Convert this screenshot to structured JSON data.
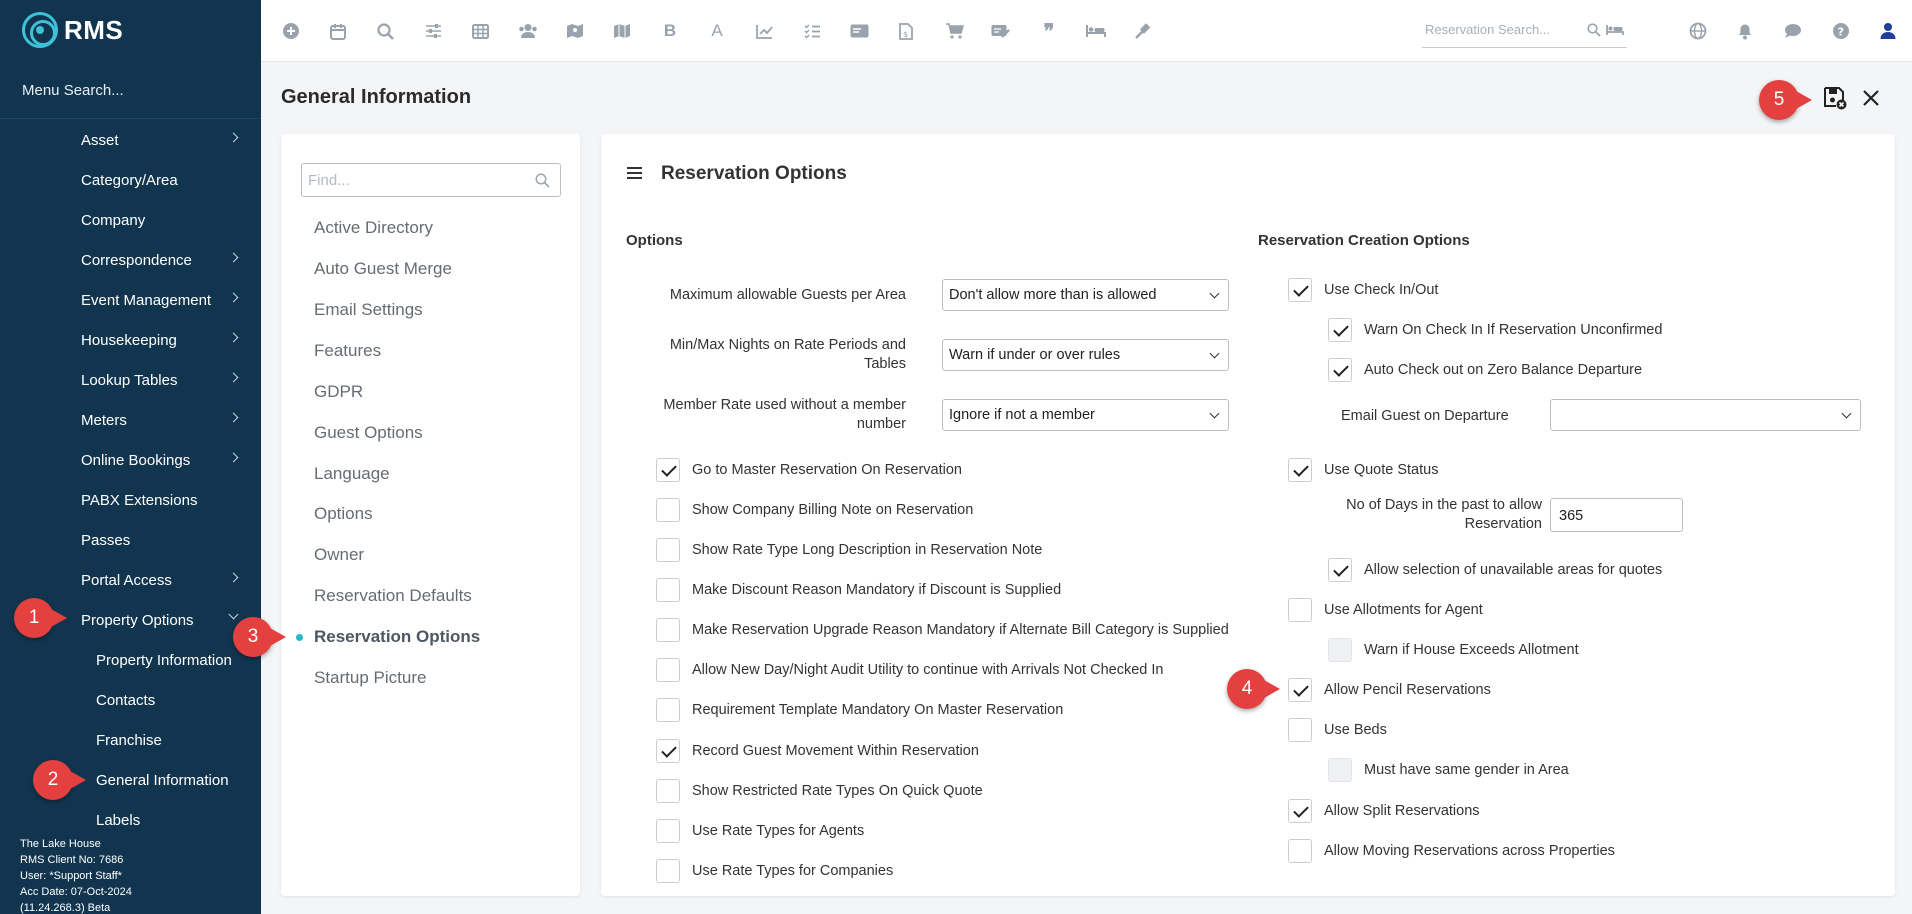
{
  "app": {
    "name": "RMS",
    "menu_search": "Menu Search..."
  },
  "sidebar": {
    "items": [
      {
        "label": "Asset",
        "has_children": true,
        "expanded": false,
        "level": 1
      },
      {
        "label": "Category/Area",
        "has_children": false,
        "level": 1
      },
      {
        "label": "Company",
        "has_children": false,
        "level": 1
      },
      {
        "label": "Correspondence",
        "has_children": true,
        "expanded": false,
        "level": 1
      },
      {
        "label": "Event Management",
        "has_children": true,
        "expanded": false,
        "level": 1
      },
      {
        "label": "Housekeeping",
        "has_children": true,
        "expanded": false,
        "level": 1
      },
      {
        "label": "Lookup Tables",
        "has_children": true,
        "expanded": false,
        "level": 1
      },
      {
        "label": "Meters",
        "has_children": true,
        "expanded": false,
        "level": 1
      },
      {
        "label": "Online Bookings",
        "has_children": true,
        "expanded": false,
        "level": 1
      },
      {
        "label": "PABX Extensions",
        "has_children": false,
        "level": 1
      },
      {
        "label": "Passes",
        "has_children": false,
        "level": 1
      },
      {
        "label": "Portal Access",
        "has_children": true,
        "expanded": false,
        "level": 1
      },
      {
        "label": "Property Options",
        "has_children": true,
        "expanded": true,
        "level": 1
      },
      {
        "label": "Property Information",
        "has_children": false,
        "level": 2
      },
      {
        "label": "Contacts",
        "has_children": false,
        "level": 2
      },
      {
        "label": "Franchise",
        "has_children": false,
        "level": 2
      },
      {
        "label": "General Information",
        "has_children": false,
        "level": 2
      },
      {
        "label": "Labels",
        "has_children": false,
        "level": 2
      }
    ],
    "footer": [
      "The Lake House",
      "RMS Client No: 7686",
      "User: *Support Staff*",
      "Acc Date: 07-Oct-2024",
      "(11.24.268.3)  Beta"
    ]
  },
  "topbar": {
    "icons": [
      "plus-circle-icon",
      "calendar-icon",
      "search-icon",
      "sliders-icon",
      "grid-icon",
      "users-icon",
      "map-pin-icon",
      "map-icon",
      "bold-icon",
      "font-icon",
      "chart-icon",
      "checklist-icon",
      "id-card-icon",
      "file-invoice-icon",
      "cart-icon",
      "ticket-edit-icon",
      "quote-icon",
      "bed-icon",
      "gavel-icon"
    ],
    "reservation_search_placeholder": "Reservation Search...",
    "right_icons": [
      "globe-icon",
      "bell-icon",
      "chat-icon",
      "help-icon",
      "user-icon"
    ]
  },
  "page": {
    "title": "General Information"
  },
  "tree": {
    "find_placeholder": "Find...",
    "items": [
      "Active Directory",
      "Auto Guest Merge",
      "Email Settings",
      "Features",
      "GDPR",
      "Guest Options",
      "Language",
      "Options",
      "Owner",
      "Reservation Defaults",
      "Reservation Options",
      "Startup Picture"
    ],
    "active": "Reservation Options"
  },
  "panel": {
    "title": "Reservation Options",
    "options": {
      "heading": "Options",
      "fields": [
        {
          "label": "Maximum allowable Guests per Area",
          "value": "Don't allow more than is allowed"
        },
        {
          "label": "Min/Max Nights on Rate Periods and Tables",
          "value": "Warn if under or over rules"
        },
        {
          "label": "Member Rate used without a member number",
          "value": "Ignore if not a member"
        }
      ],
      "checkboxes": [
        {
          "label": "Go to Master Reservation On Reservation",
          "checked": true
        },
        {
          "label": "Show Company Billing Note on Reservation",
          "checked": false
        },
        {
          "label": "Show Rate Type Long Description in Reservation Note",
          "checked": false
        },
        {
          "label": "Make Discount Reason Mandatory if Discount is Supplied",
          "checked": false
        },
        {
          "label": "Make Reservation Upgrade Reason Mandatory if Alternate Bill Category is Supplied",
          "checked": false
        },
        {
          "label": "Allow New Day/Night Audit Utility to continue with Arrivals Not Checked In",
          "checked": false
        },
        {
          "label": "Requirement Template Mandatory On Master Reservation",
          "checked": false
        },
        {
          "label": "Record Guest Movement Within Reservation",
          "checked": true
        },
        {
          "label": "Show Restricted Rate Types On Quick Quote",
          "checked": false
        },
        {
          "label": "Use Rate Types for Agents",
          "checked": false
        },
        {
          "label": "Use Rate Types for Companies",
          "checked": false
        }
      ]
    },
    "creation": {
      "heading": "Reservation Creation Options",
      "use_check_in_out": {
        "label": "Use Check In/Out",
        "checked": true
      },
      "warn_unconfirmed": {
        "label": "Warn On Check In If Reservation Unconfirmed",
        "checked": true
      },
      "auto_checkout": {
        "label": "Auto Check out on Zero Balance Departure",
        "checked": true
      },
      "email_guest": {
        "label": "Email Guest on Departure",
        "value": ""
      },
      "use_quote_status": {
        "label": "Use Quote Status",
        "checked": true
      },
      "days_past": {
        "label": "No of Days in the past to allow Reservation",
        "value": "365"
      },
      "allow_unavailable": {
        "label": "Allow selection of unavailable areas for quotes",
        "checked": true
      },
      "use_allotments": {
        "label": "Use Allotments for Agent",
        "checked": false
      },
      "warn_allotment": {
        "label": "Warn if House Exceeds Allotment",
        "checked": false
      },
      "allow_pencil": {
        "label": "Allow Pencil Reservations",
        "checked": true
      },
      "use_beds": {
        "label": "Use Beds",
        "checked": false
      },
      "same_gender": {
        "label": "Must have same gender in Area",
        "checked": false
      },
      "allow_split": {
        "label": "Allow Split Reservations",
        "checked": true
      },
      "allow_moving": {
        "label": "Allow Moving Reservations across Properties",
        "checked": false
      }
    }
  },
  "callouts": [
    "1",
    "2",
    "3",
    "4",
    "5"
  ],
  "colors": {
    "sidebar": "#12354f",
    "accent": "#3fc1d8",
    "callout": "#e3403f",
    "active_dot": "#25b6cf"
  }
}
